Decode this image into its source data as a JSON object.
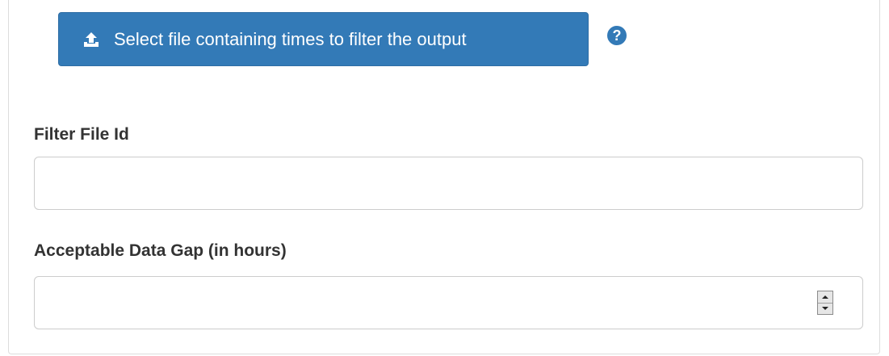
{
  "upload": {
    "button_label": "Select file containing times to filter the output",
    "upload_icon": "upload-icon",
    "help_icon": "question-circle-icon",
    "accent_color": "#337ab7"
  },
  "fields": {
    "filter_file_id": {
      "label": "Filter File Id",
      "value": "",
      "placeholder": ""
    },
    "acceptable_data_gap": {
      "label": "Acceptable Data Gap (in hours)",
      "value": "",
      "placeholder": "",
      "spinner_icon": "number-spinner-icon"
    }
  }
}
